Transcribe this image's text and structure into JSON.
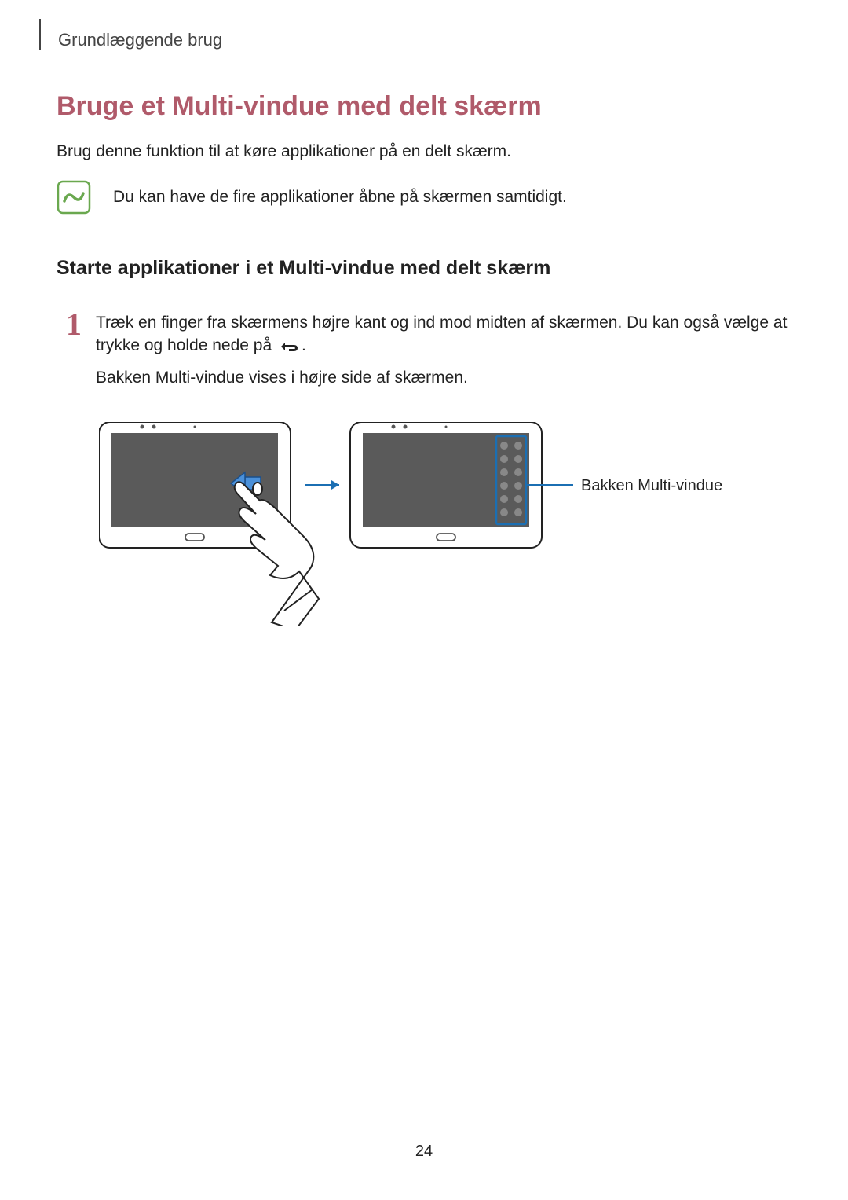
{
  "runningHeader": "Grundlæggende brug",
  "heading1": "Bruge et Multi-vindue med delt skærm",
  "introText": "Brug denne funktion til at køre applikationer på en delt skærm.",
  "noteText": "Du kan have de fire applikationer åbne på skærmen samtidigt.",
  "heading2": "Starte applikationer i et Multi-vindue med delt skærm",
  "step1": {
    "number": "1",
    "textPart1": "Træk en finger fra skærmens højre kant og ind mod midten af skærmen. Du kan også vælge at trykke og holde nede på ",
    "textPart2": ".",
    "followup": "Bakken Multi-vindue vises i højre side af skærmen."
  },
  "calloutLabel": "Bakken Multi-vindue",
  "pageNumber": "24"
}
